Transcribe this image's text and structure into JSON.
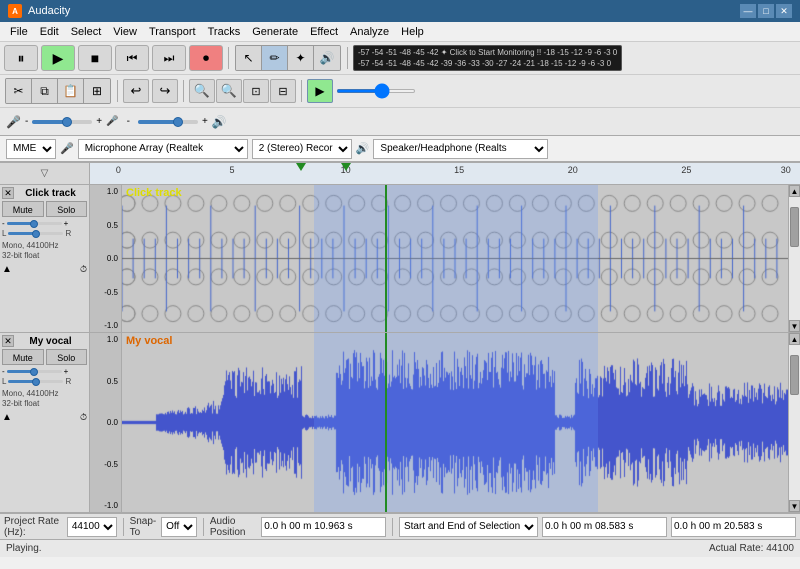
{
  "app": {
    "title": "Audacity"
  },
  "titlebar": {
    "title": "Audacity",
    "minimize": "—",
    "maximize": "□",
    "close": "✕"
  },
  "menu": {
    "items": [
      "File",
      "Edit",
      "Select",
      "View",
      "Transport",
      "Tracks",
      "Generate",
      "Effect",
      "Analyze",
      "Help"
    ]
  },
  "tracks": [
    {
      "id": "click-track",
      "name": "Click track",
      "label": "Click track",
      "label_color": "#dddd00",
      "mute": "Mute",
      "solo": "Solo",
      "meta": "Mono, 44100Hz\n32-bit float",
      "height": 145
    },
    {
      "id": "my-vocal",
      "name": "My vocal",
      "label": "My vocal",
      "label_color": "#dd6600",
      "mute": "Mute",
      "solo": "Solo",
      "meta": "Mono, 44100Hz\n32-bit float",
      "height": 180
    }
  ],
  "devices": {
    "audio_host": "MME",
    "input_device": "Microphone Array (Realtek",
    "input_channels": "2 (Stereo) Recor",
    "output_device": "Speaker/Headphone (Realts",
    "click_to_monitor": "Click to Start Monitoring"
  },
  "timeline": {
    "marks": [
      0,
      5,
      10,
      15,
      20,
      25,
      30
    ]
  },
  "bottom_bar": {
    "project_rate_label": "Project Rate (Hz):",
    "project_rate_value": "44100",
    "snap_to_label": "Snap-To",
    "snap_to_value": "Off",
    "audio_position_label": "Audio Position",
    "audio_position_value": "0.0 h 00 m 10.963 s",
    "selection_label": "Start and End of Selection",
    "selection_start": "0.0 h 00 m 08.583 s",
    "selection_end": "0.0 h 00 m 20.583 s"
  },
  "status": {
    "left": "Playing.",
    "right": "Actual Rate: 44100"
  }
}
